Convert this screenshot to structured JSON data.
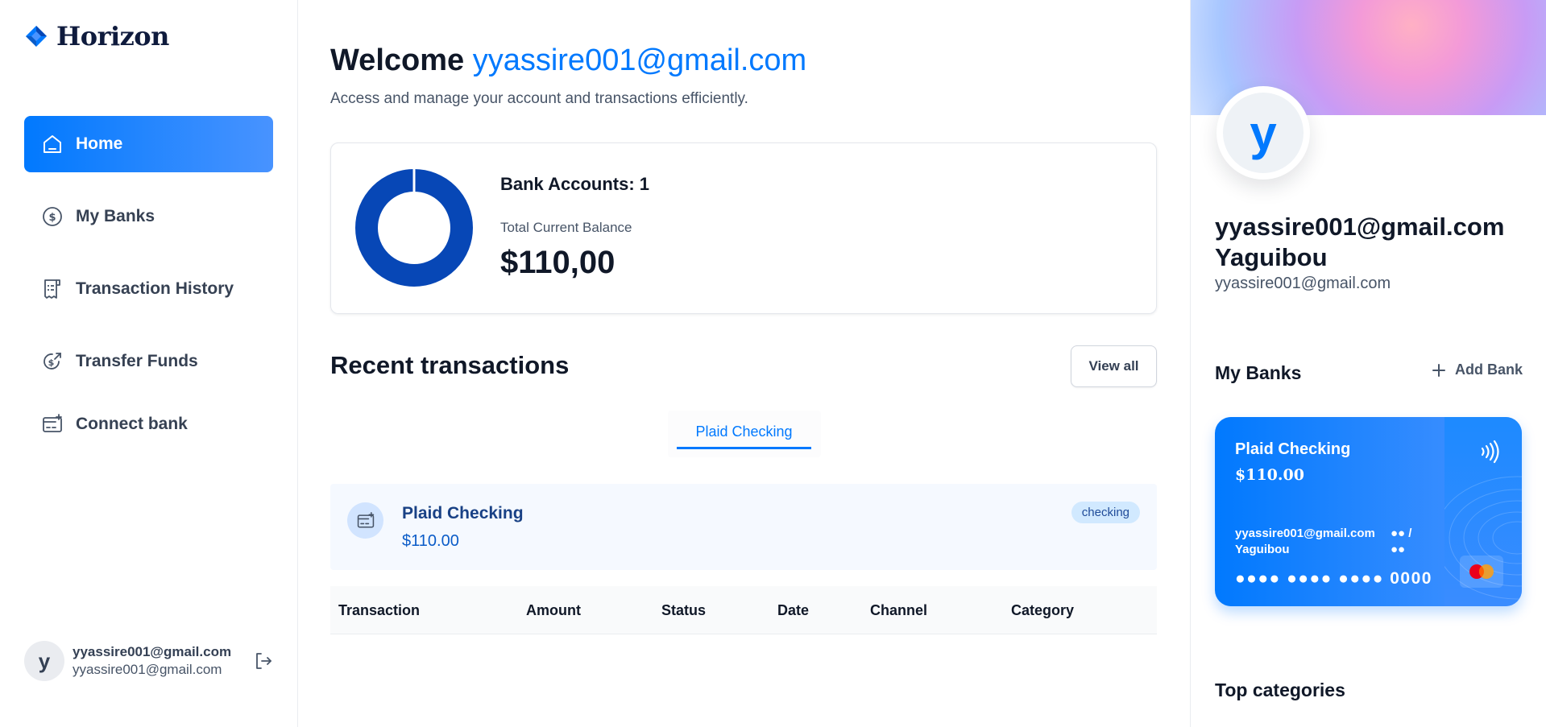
{
  "app": {
    "brand": "Horizon"
  },
  "sidebar": {
    "items": [
      {
        "label": "Home",
        "icon": "home-icon",
        "active": true
      },
      {
        "label": "My Banks",
        "icon": "dollar-circle-icon",
        "active": false
      },
      {
        "label": "Transaction History",
        "icon": "receipt-icon",
        "active": false
      },
      {
        "label": "Transfer Funds",
        "icon": "money-send-icon",
        "active": false
      },
      {
        "label": "Connect bank",
        "icon": "card-add-icon",
        "active": false
      }
    ],
    "footer": {
      "avatar_letter": "y",
      "name": "yyassire001@gmail.com",
      "email": "yyassire001@gmail.com"
    }
  },
  "header": {
    "welcome_prefix": "Welcome",
    "user": "yyassire001@gmail.com",
    "subtitle": "Access and manage your account and transactions efficiently."
  },
  "balance": {
    "bank_accounts_label": "Bank Accounts: 1",
    "total_label": "Total Current Balance",
    "total_value": "$110,00"
  },
  "recent": {
    "title": "Recent transactions",
    "view_all": "View all",
    "tabs": [
      "Plaid Checking"
    ],
    "bank_info": {
      "name": "Plaid Checking",
      "amount": "$110.00",
      "badge": "checking"
    },
    "table_headers": [
      "Transaction",
      "Amount",
      "Status",
      "Date",
      "Channel",
      "Category"
    ]
  },
  "profile": {
    "avatar_letter": "y",
    "name_line1": "yyassire001@gmail.com",
    "name_line2": "Yaguibou",
    "email": "yyassire001@gmail.com"
  },
  "my_banks": {
    "title": "My Banks",
    "add_label": "Add Bank",
    "card": {
      "name": "Plaid Checking",
      "amount": "$110.00",
      "holder_line1": "yyassire001@gmail.com",
      "holder_line2": "Yaguibou",
      "exp_line1": "●● /",
      "exp_line2": "●●",
      "number": "●●●● ●●●● ●●●● 0000"
    }
  },
  "top_categories": {
    "title": "Top categories"
  },
  "colors": {
    "accent": "#0179fe",
    "donut": "#0747b6"
  }
}
